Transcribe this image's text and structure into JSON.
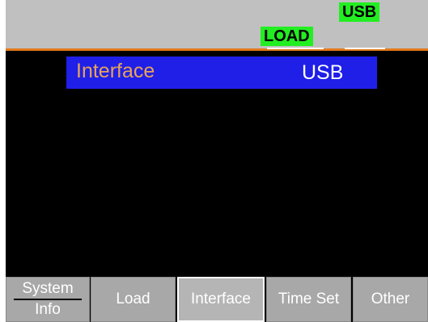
{
  "status": {
    "interface_badge": "USB",
    "mode_badge": "LOAD"
  },
  "setting": {
    "label": "Interface",
    "value": "USB"
  },
  "softkeys": {
    "system_line1": "System",
    "system_line2": "Info",
    "load": "Load",
    "interface": "Interface",
    "time_set": "Time Set",
    "other": "Other"
  },
  "colors": {
    "badge_green": "#22ee22",
    "status_gray": "#c0c0c0",
    "accent_orange": "#e07a1c",
    "selection_blue": "#1f1fe8",
    "label_orange": "#e8a25a"
  }
}
